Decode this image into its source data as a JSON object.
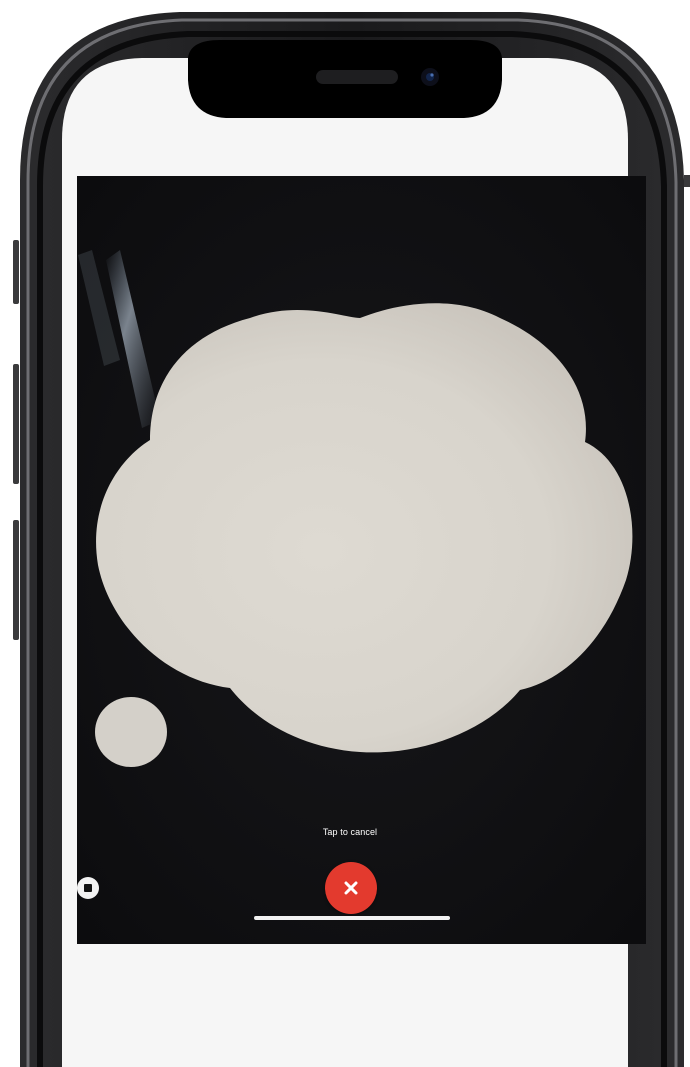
{
  "device": {
    "frame_color": "#1c1c1e",
    "screen_background": "#f6f6f6",
    "camera_background": "#111114",
    "object_color": "#d9d5ce"
  },
  "camera_view": {
    "hint_text": "Tap to cancel",
    "cancel_icon": "close-icon",
    "stop_icon": "stop-icon",
    "cancel_color": "#e33a2e"
  }
}
